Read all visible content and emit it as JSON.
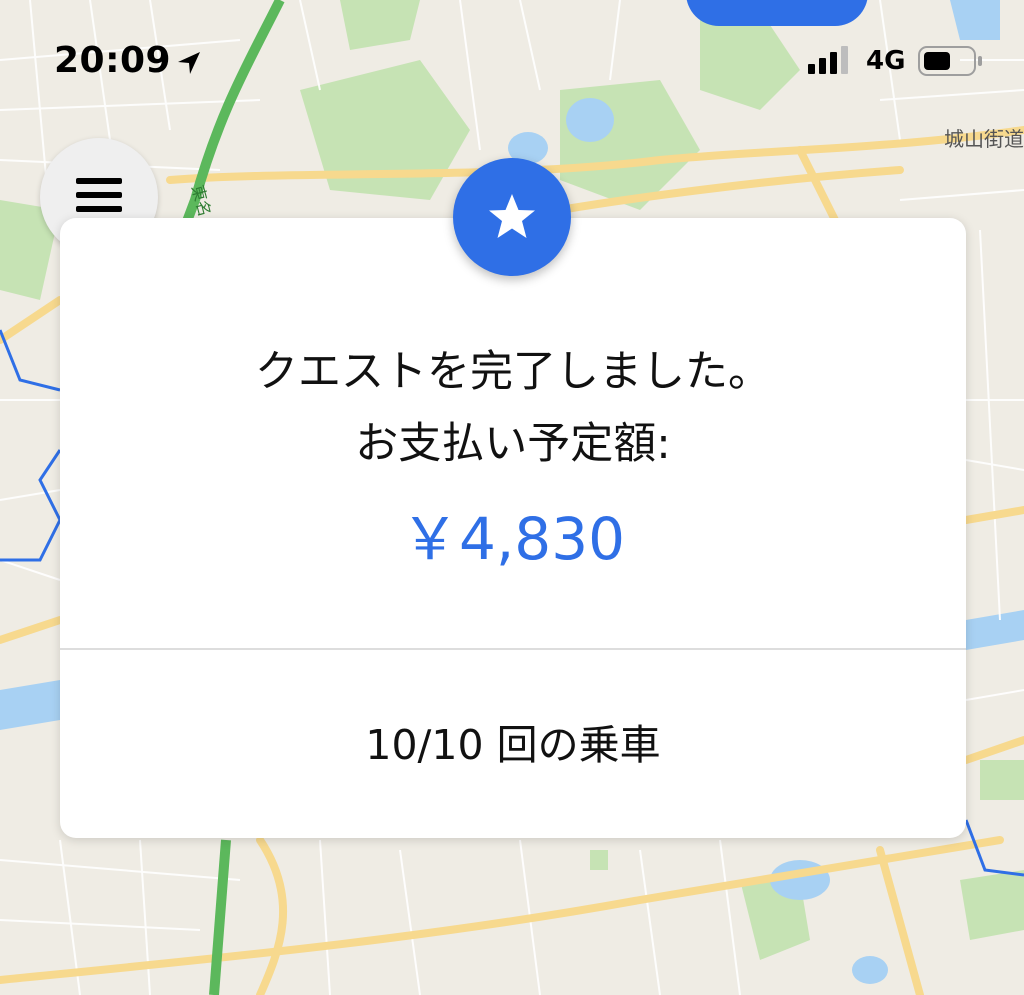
{
  "status_bar": {
    "time": "20:09",
    "network": "4G",
    "location_icon": "location-arrow-icon",
    "signal_icon": "cellular-signal-icon",
    "battery_icon": "battery-icon"
  },
  "map": {
    "labels": {
      "road_top_right": "城山街道",
      "road_vertical": "東名"
    },
    "colors": {
      "land": "#efece4",
      "park": "#c6e3b4",
      "water": "#a8d1f3",
      "road_major": "#f7d98e",
      "highway": "#5cb85c",
      "route_line": "#2f6fe6"
    }
  },
  "menu_button": {
    "icon": "hamburger-menu-icon"
  },
  "card": {
    "badge_icon": "star-icon",
    "line1": "クエストを完了しました。",
    "line2": "お支払い予定額:",
    "amount": "￥4,830",
    "rides": "10/10 回の乗車",
    "accent_color": "#2f6fe6"
  }
}
